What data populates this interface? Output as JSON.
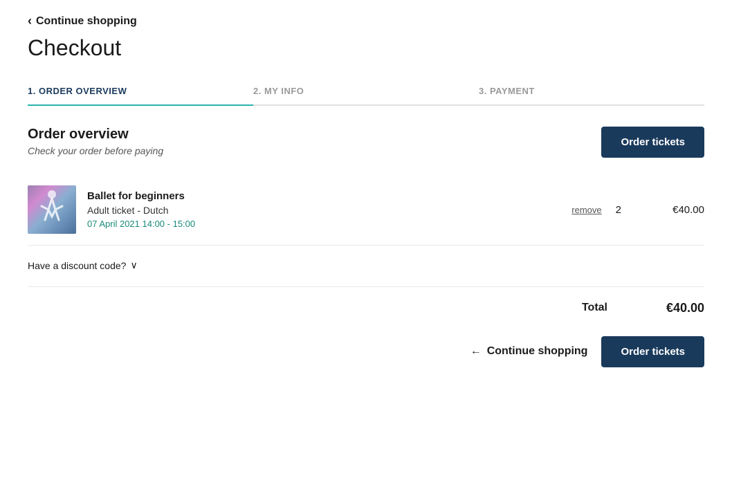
{
  "back_link": {
    "label": "Continue shopping",
    "arrow": "‹"
  },
  "page_title": "Checkout",
  "tabs": [
    {
      "id": "order-overview",
      "label": "1. ORDER OVERVIEW",
      "active": true
    },
    {
      "id": "my-info",
      "label": "2. MY INFO",
      "active": false
    },
    {
      "id": "payment",
      "label": "3. PAYMENT",
      "active": false
    }
  ],
  "order_section": {
    "title": "Order overview",
    "subtitle": "Check your order before paying",
    "order_tickets_button": "Order tickets"
  },
  "order_item": {
    "name": "Ballet for beginners",
    "ticket_type": "Adult ticket - Dutch",
    "date": "07 April 2021 14:00 - 15:00",
    "remove_label": "remove",
    "quantity": "2",
    "price": "€40.00"
  },
  "discount": {
    "label": "Have a discount code?",
    "chevron": "∨"
  },
  "total": {
    "label": "Total",
    "amount": "€40.00"
  },
  "bottom_actions": {
    "continue_shopping_label": "Continue shopping",
    "arrow_left": "←",
    "order_tickets_button": "Order tickets"
  }
}
